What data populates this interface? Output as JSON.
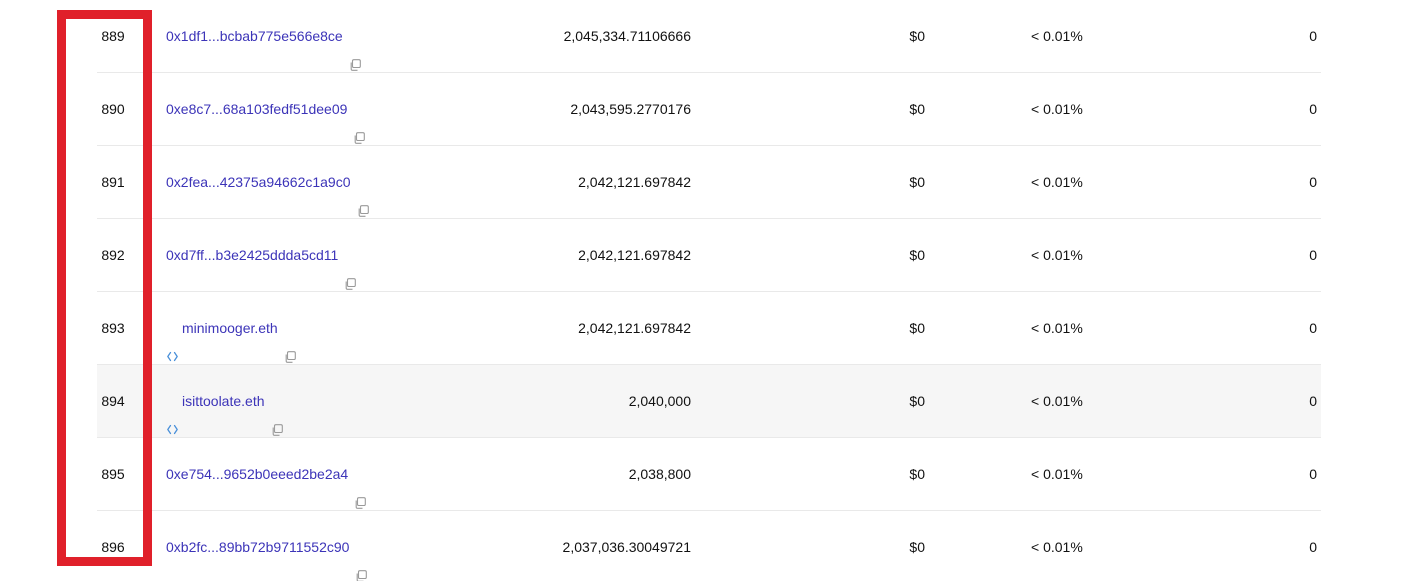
{
  "accent_colors": {
    "link": "#3c34b8",
    "highlight_box": "#e0202a",
    "row_hover": "#f6f6f6",
    "ens_icon": "#4a90d9"
  },
  "rows": [
    {
      "rank": "889",
      "address": "0x1df1...bcbab775e566e8ce",
      "ens": false,
      "quantity": "2,045,334.71106666",
      "value": "$0",
      "percentage": "< 0.01%",
      "count": "0"
    },
    {
      "rank": "890",
      "address": "0xe8c7...68a103fedf51dee09",
      "ens": false,
      "quantity": "2,043,595.2770176",
      "value": "$0",
      "percentage": "< 0.01%",
      "count": "0"
    },
    {
      "rank": "891",
      "address": "0x2fea...42375a94662c1a9c0",
      "ens": false,
      "quantity": "2,042,121.697842",
      "value": "$0",
      "percentage": "< 0.01%",
      "count": "0"
    },
    {
      "rank": "892",
      "address": "0xd7ff...b3e2425ddda5cd11",
      "ens": false,
      "quantity": "2,042,121.697842",
      "value": "$0",
      "percentage": "< 0.01%",
      "count": "0"
    },
    {
      "rank": "893",
      "address": "minimooger.eth",
      "ens": true,
      "quantity": "2,042,121.697842",
      "value": "$0",
      "percentage": "< 0.01%",
      "count": "0"
    },
    {
      "rank": "894",
      "address": "isittoolate.eth",
      "ens": true,
      "quantity": "2,040,000",
      "value": "$0",
      "percentage": "< 0.01%",
      "count": "0",
      "highlighted": true
    },
    {
      "rank": "895",
      "address": "0xe754...9652b0eeed2be2a4",
      "ens": false,
      "quantity": "2,038,800",
      "value": "$0",
      "percentage": "< 0.01%",
      "count": "0"
    },
    {
      "rank": "896",
      "address": "0xb2fc...89bb72b9711552c90",
      "ens": false,
      "quantity": "2,037,036.30049721",
      "value": "$0",
      "percentage": "< 0.01%",
      "count": "0"
    }
  ]
}
